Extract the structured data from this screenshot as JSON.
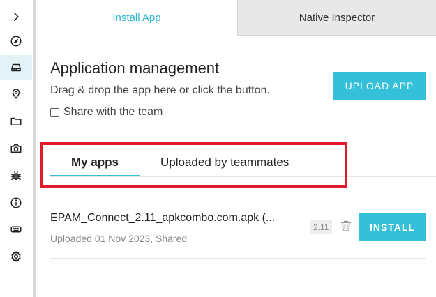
{
  "tabs": {
    "install_app": "Install App",
    "native_inspector": "Native Inspector"
  },
  "header": {
    "title": "Application management",
    "subtitle": "Drag & drop the app here or click the button.",
    "share_label": "Share with the team",
    "share_checked": false,
    "upload_label": "UPLOAD APP"
  },
  "subtabs": {
    "my_apps": "My apps",
    "uploaded_by_teammates": "Uploaded by teammates",
    "active": "My apps"
  },
  "apps": [
    {
      "name": "EPAM_Connect_2.11_apkcombo.com.apk (...",
      "meta": "Uploaded 01 Nov 2023, Shared",
      "version": "2.11",
      "install_label": "INSTALL"
    }
  ],
  "sidebar": {
    "items": [
      "expand-chevron",
      "compass",
      "device-drawer",
      "location-pin",
      "folder",
      "camera",
      "bug",
      "info",
      "keyboard",
      "settings"
    ],
    "active": "device-drawer"
  },
  "colors": {
    "accent": "#33c0d8",
    "highlight": "#e21b2a",
    "inactive_tab_bg": "#e8e8e8"
  }
}
